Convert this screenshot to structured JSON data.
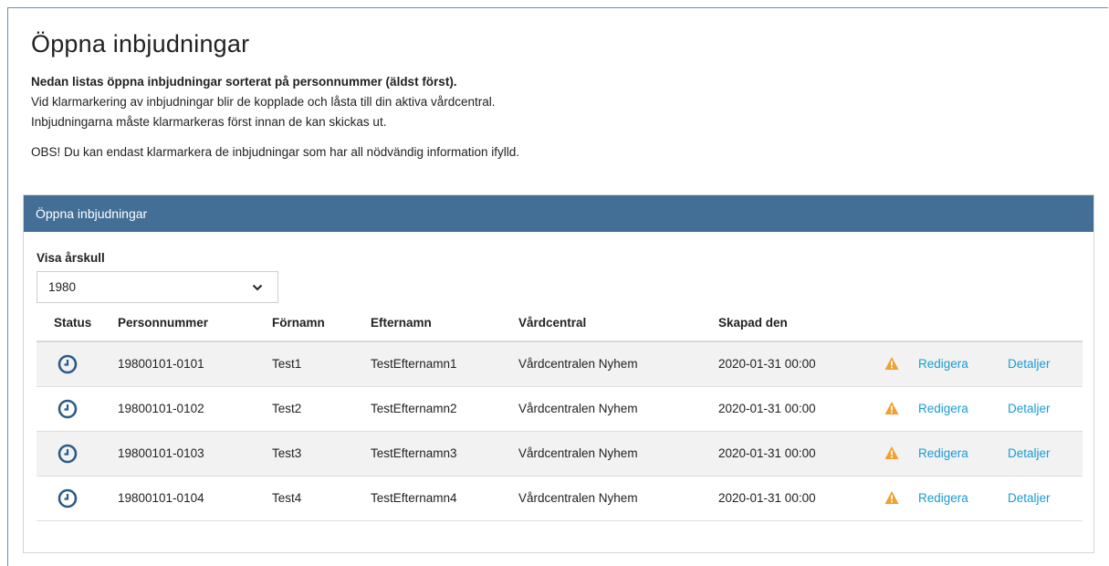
{
  "page": {
    "title": "Öppna inbjudningar",
    "intro_bold": "Nedan listas öppna inbjudningar sorterat på personnummer (äldst först).",
    "intro_line2": "Vid klarmarkering av inbjudningar blir de kopplade och låsta till din aktiva vårdcentral.",
    "intro_line3": "Inbjudningarna måste klarmarkeras först innan de kan skickas ut.",
    "obs": "OBS! Du kan endast klarmarkera de inbjudningar som har all nödvändig information ifylld."
  },
  "panel": {
    "header": "Öppna inbjudningar",
    "filter_label": "Visa årskull",
    "filter_value": "1980"
  },
  "table": {
    "headers": {
      "status": "Status",
      "personnummer": "Personnummer",
      "fornamn": "Förnamn",
      "efternamn": "Efternamn",
      "vardcentral": "Vårdcentral",
      "skapad": "Skapad den"
    },
    "rows": [
      {
        "personnummer": "19800101-0101",
        "fornamn": "Test1",
        "efternamn": "TestEfternamn1",
        "vardcentral": "Vårdcentralen Nyhem",
        "skapad": "2020-01-31 00:00",
        "edit": "Redigera",
        "details": "Detaljer"
      },
      {
        "personnummer": "19800101-0102",
        "fornamn": "Test2",
        "efternamn": "TestEfternamn2",
        "vardcentral": "Vårdcentralen Nyhem",
        "skapad": "2020-01-31 00:00",
        "edit": "Redigera",
        "details": "Detaljer"
      },
      {
        "personnummer": "19800101-0103",
        "fornamn": "Test3",
        "efternamn": "TestEfternamn3",
        "vardcentral": "Vårdcentralen Nyhem",
        "skapad": "2020-01-31 00:00",
        "edit": "Redigera",
        "details": "Detaljer"
      },
      {
        "personnummer": "19800101-0104",
        "fornamn": "Test4",
        "efternamn": "TestEfternamn4",
        "vardcentral": "Vårdcentralen Nyhem",
        "skapad": "2020-01-31 00:00",
        "edit": "Redigera",
        "details": "Detaljer"
      }
    ]
  },
  "icons": {
    "status": "clock-icon",
    "warning": "warning-icon",
    "select_arrow": "chevron-down-icon"
  },
  "colors": {
    "header_bg": "#436e95",
    "link": "#1a9bd1",
    "warning": "#f0a030",
    "status_icon": "#2c5b87"
  }
}
